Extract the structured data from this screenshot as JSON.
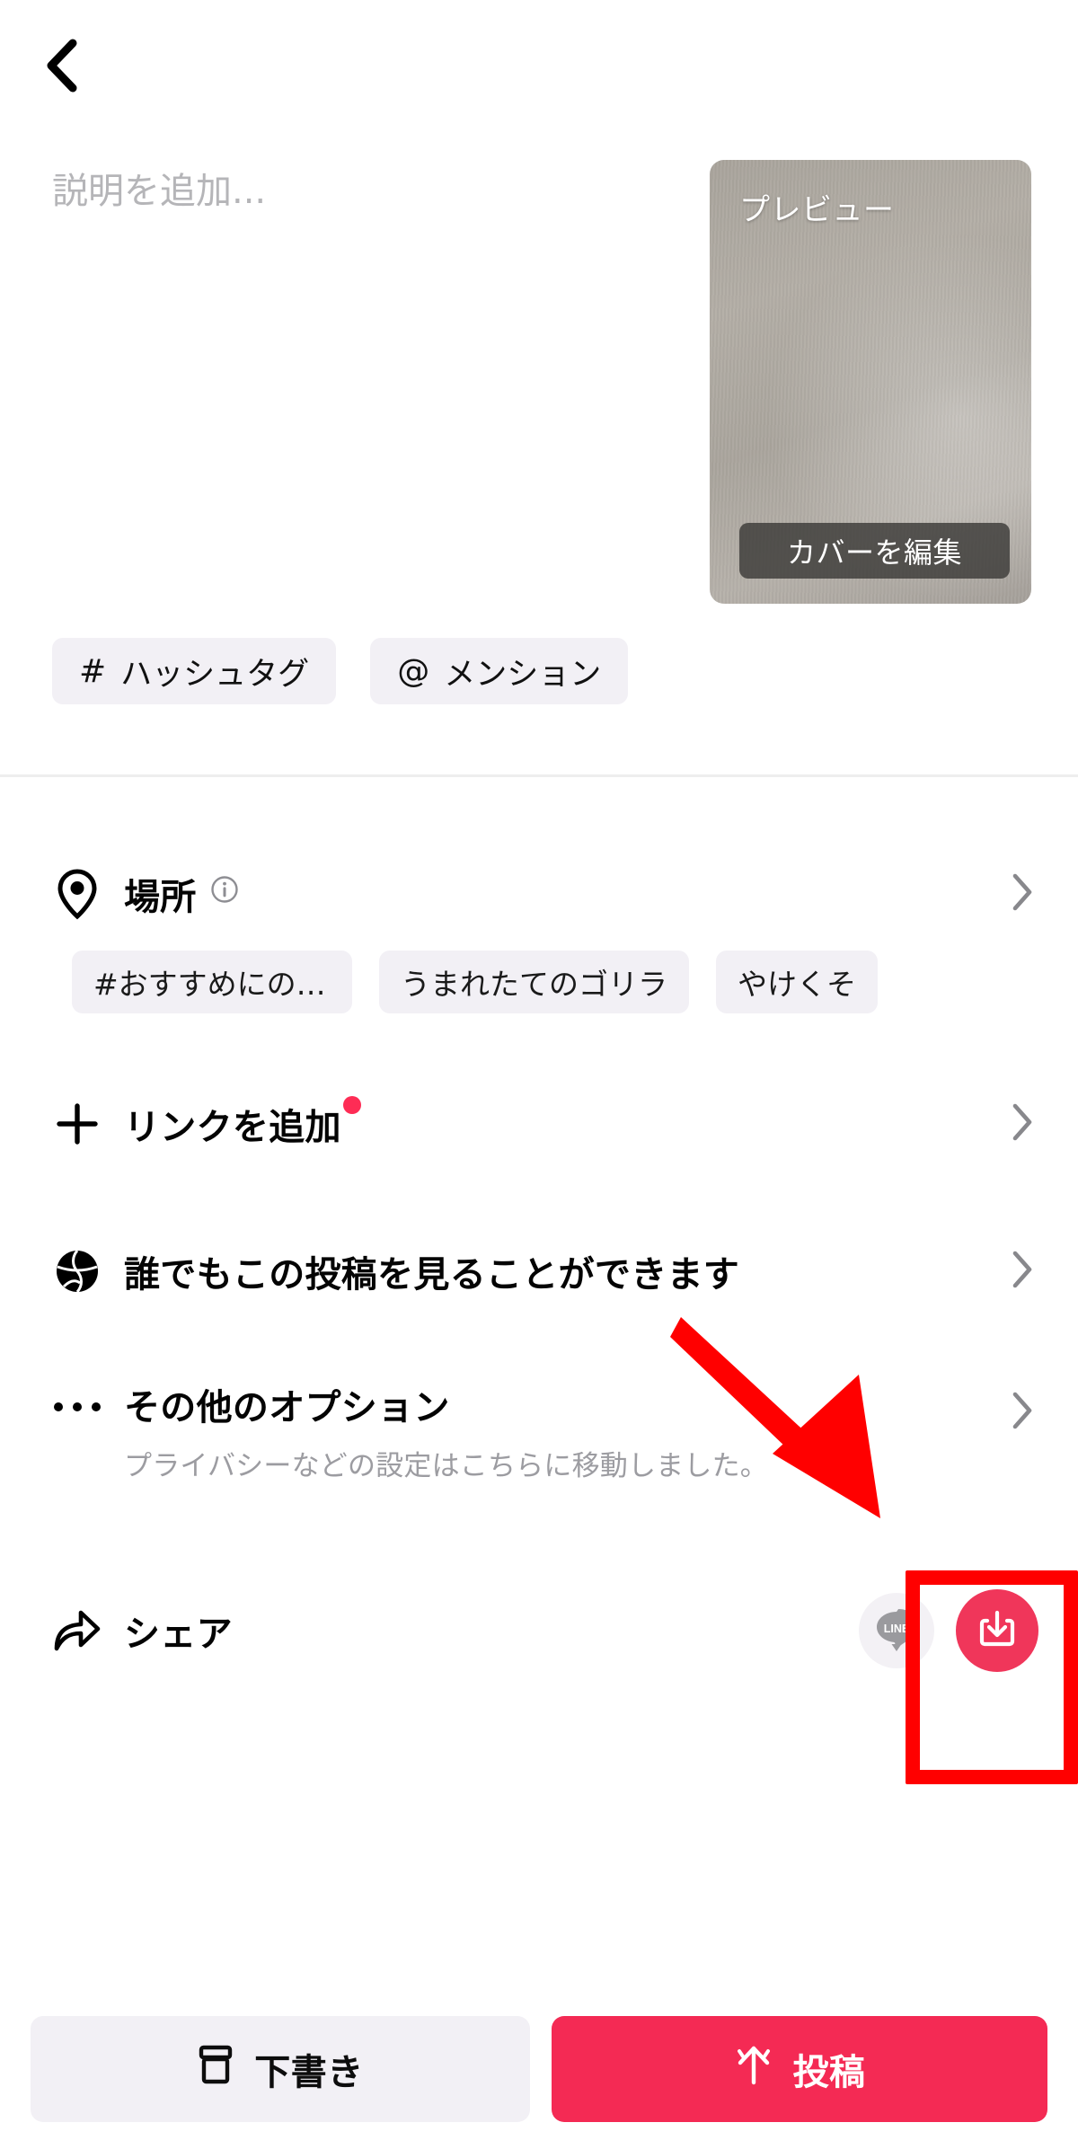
{
  "header": {
    "back_icon": "chevron-left-icon"
  },
  "caption": {
    "placeholder": "説明を追加..."
  },
  "thumbnail": {
    "preview_label": "プレビュー",
    "edit_cover_label": "カバーを編集"
  },
  "tag_buttons": [
    {
      "symbol": "#",
      "label": "ハッシュタグ",
      "icon": "hashtag-icon"
    },
    {
      "symbol": "@",
      "label": "メンション",
      "icon": "mention-icon"
    }
  ],
  "rows": {
    "location": {
      "title": "場所",
      "icon": "location-pin-icon",
      "info_icon": "info-circle-icon",
      "chevron": "chevron-right-icon"
    },
    "add_link": {
      "title": "リンクを追加",
      "icon": "plus-icon",
      "badge": "red-dot-badge",
      "chevron": "chevron-right-icon"
    },
    "privacy": {
      "title": "誰でもこの投稿を見ることができます",
      "icon": "globe-icon",
      "chevron": "chevron-right-icon"
    },
    "more_options": {
      "title": "その他のオプション",
      "subtitle": "プライバシーなどの設定はこちらに移動しました。",
      "icon": "ellipsis-icon",
      "chevron": "chevron-right-icon"
    },
    "share": {
      "title": "シェア",
      "icon": "share-arrow-icon",
      "line_label": "LINE",
      "line_icon": "line-app-icon",
      "save_icon": "save-download-icon"
    }
  },
  "location_chips": [
    {
      "label": "#おすすめにのりた…"
    },
    {
      "label": "うまれたてのゴリラ"
    },
    {
      "label": "やけくそ"
    }
  ],
  "bottom": {
    "draft_label": "下書き",
    "draft_icon": "archive-box-icon",
    "post_label": "投稿",
    "post_icon": "upload-icon"
  },
  "colors": {
    "accent_pink": "#f42a54",
    "save_button": "#f0365a",
    "badge_dot": "#fe2c55",
    "annotation_red": "#ff0000",
    "pill_bg": "#f2f0f5",
    "muted_text": "#9c9ca1"
  }
}
